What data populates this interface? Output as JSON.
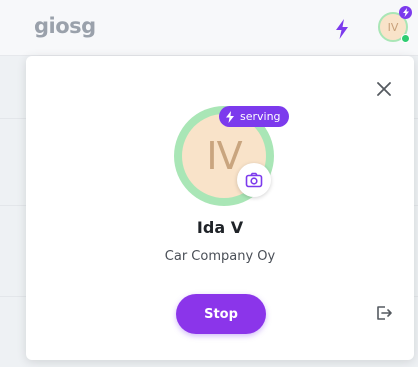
{
  "header": {
    "logo_text": "giosg",
    "bolt_icon": "bolt-icon",
    "avatar_initials": "IV",
    "accent_color": "#7c3aed",
    "status_color": "#2ecc71"
  },
  "profile_panel": {
    "close_icon": "close-icon",
    "avatar_initials": "IV",
    "serving_label": "serving",
    "camera_icon": "camera-icon",
    "name": "Ida V",
    "company": "Car Company Oy",
    "stop_label": "Stop",
    "logout_icon": "logout-icon"
  }
}
